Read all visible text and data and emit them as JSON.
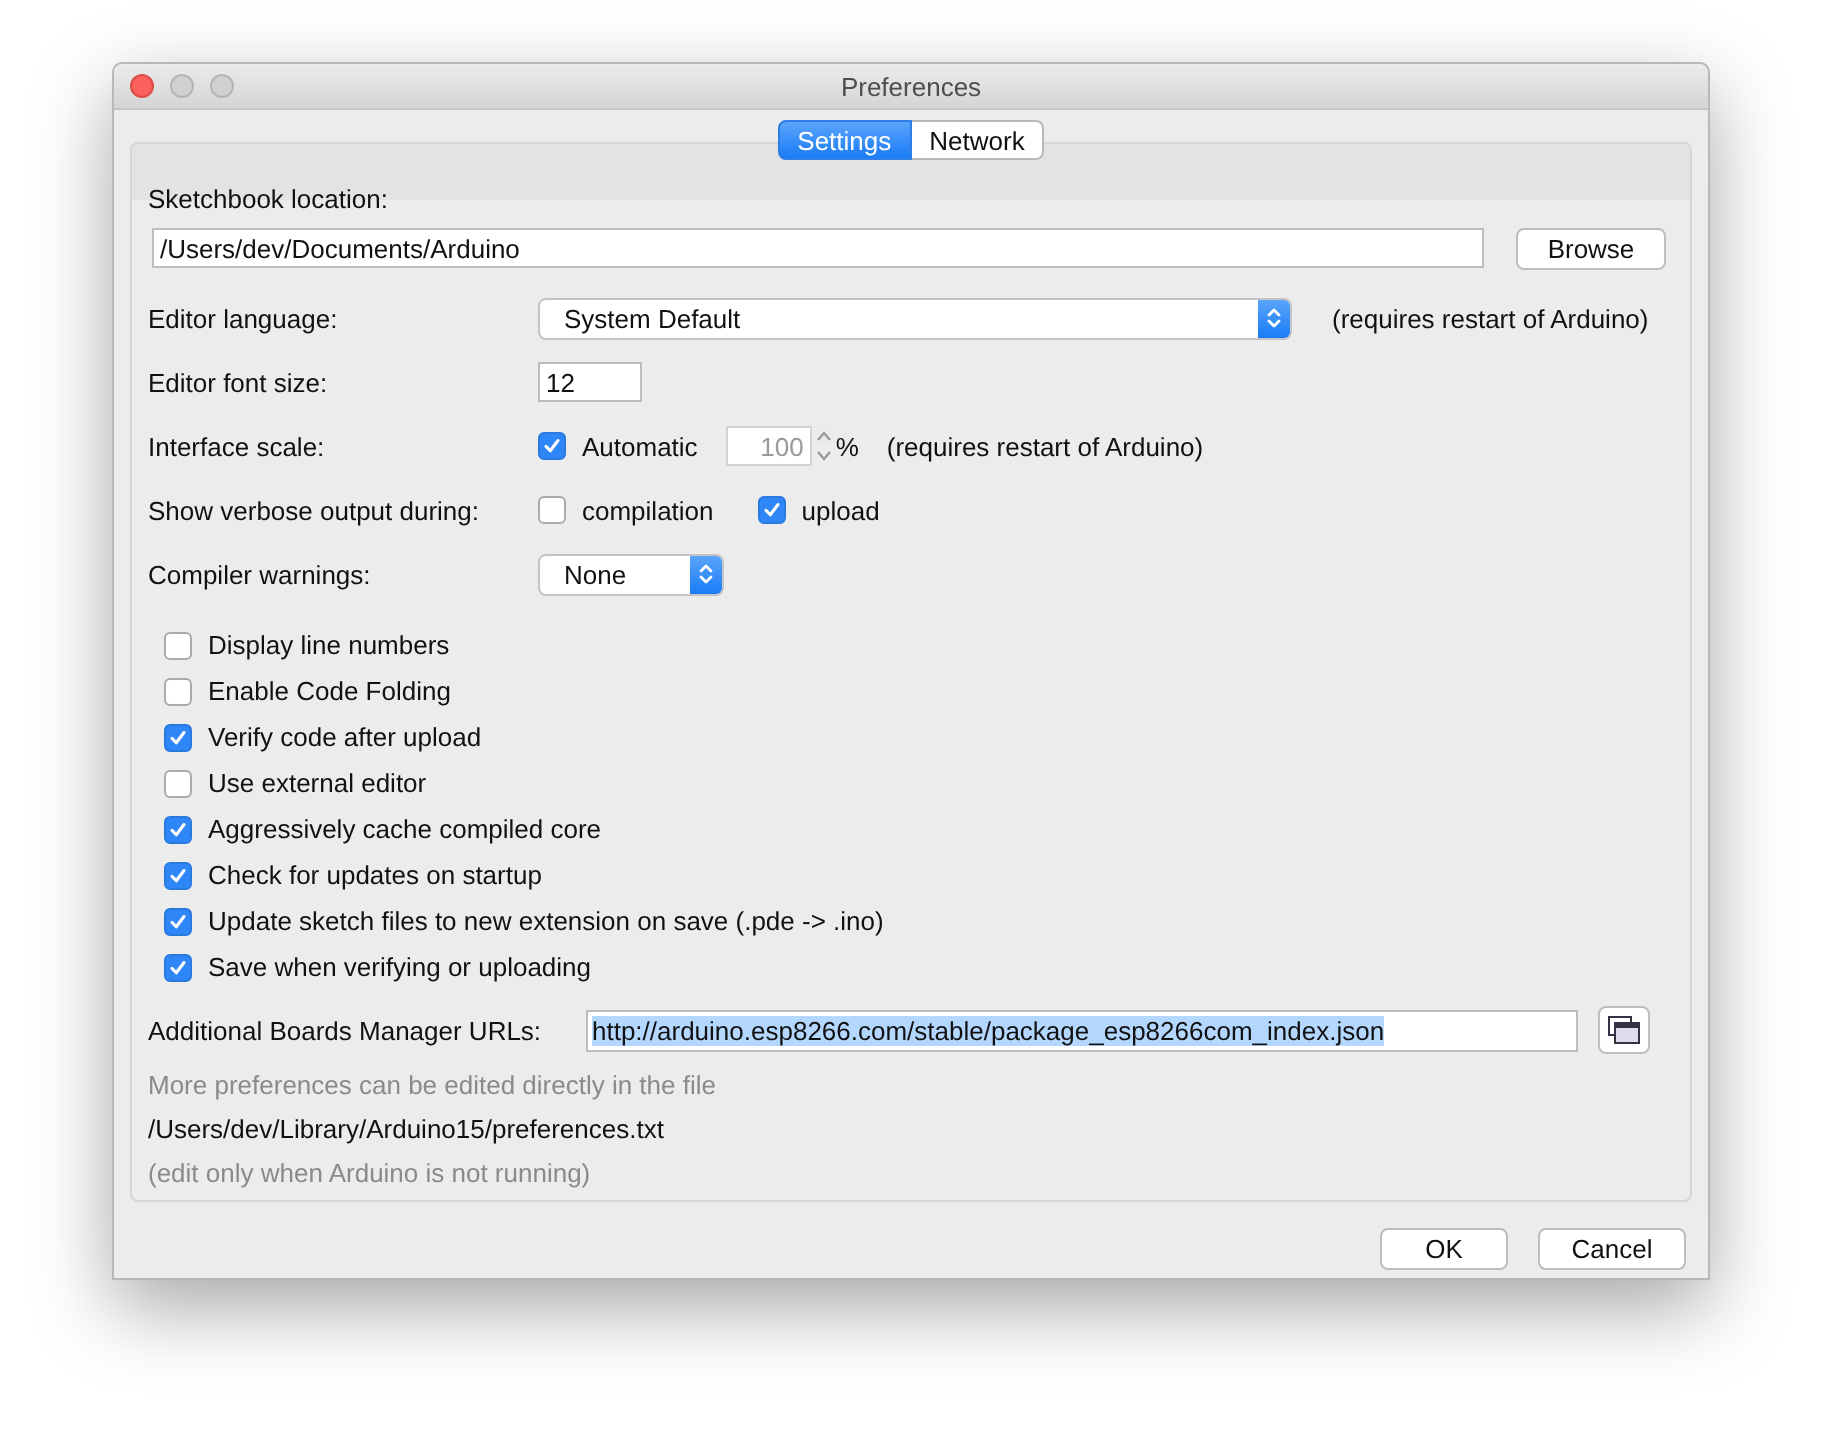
{
  "window": {
    "title": "Preferences"
  },
  "tabs": [
    {
      "label": "Settings",
      "selected": true
    },
    {
      "label": "Network",
      "selected": false
    }
  ],
  "sketchbook": {
    "label": "Sketchbook location:",
    "value": "/Users/dev/Documents/Arduino",
    "button": "Browse"
  },
  "editor_language": {
    "label": "Editor language:",
    "value": "System Default",
    "note": "(requires restart of Arduino)"
  },
  "font_size": {
    "label": "Editor font size:",
    "value": "12"
  },
  "interface_scale": {
    "label": "Interface scale:",
    "automatic": {
      "label": "Automatic",
      "checked": true
    },
    "value": "100",
    "disabled": true,
    "unit": "%",
    "note": "(requires restart of Arduino)"
  },
  "verbose": {
    "label": "Show verbose output during:",
    "options": [
      {
        "label": "compilation",
        "checked": false
      },
      {
        "label": "upload",
        "checked": true
      }
    ]
  },
  "compiler_warnings": {
    "label": "Compiler warnings:",
    "value": "None"
  },
  "options": [
    {
      "label": "Display line numbers",
      "checked": false
    },
    {
      "label": "Enable Code Folding",
      "checked": false
    },
    {
      "label": "Verify code after upload",
      "checked": true
    },
    {
      "label": "Use external editor",
      "checked": false
    },
    {
      "label": "Aggressively cache compiled core",
      "checked": true
    },
    {
      "label": "Check for updates on startup",
      "checked": true
    },
    {
      "label": "Update sketch files to new extension on save (.pde -> .ino)",
      "checked": true
    },
    {
      "label": "Save when verifying or uploading",
      "checked": true
    }
  ],
  "boards_urls": {
    "label": "Additional Boards Manager URLs:",
    "value": "http://arduino.esp8266.com/stable/package_esp8266com_index.json",
    "text_selected": true
  },
  "notes": [
    {
      "text": "More preferences can be edited directly in the file",
      "kind": "hint"
    },
    {
      "text": "/Users/dev/Library/Arduino15/preferences.txt",
      "kind": "path"
    },
    {
      "text": "(edit only when Arduino is not running)",
      "kind": "hint"
    }
  ],
  "buttons": [
    "OK",
    "Cancel"
  ]
}
